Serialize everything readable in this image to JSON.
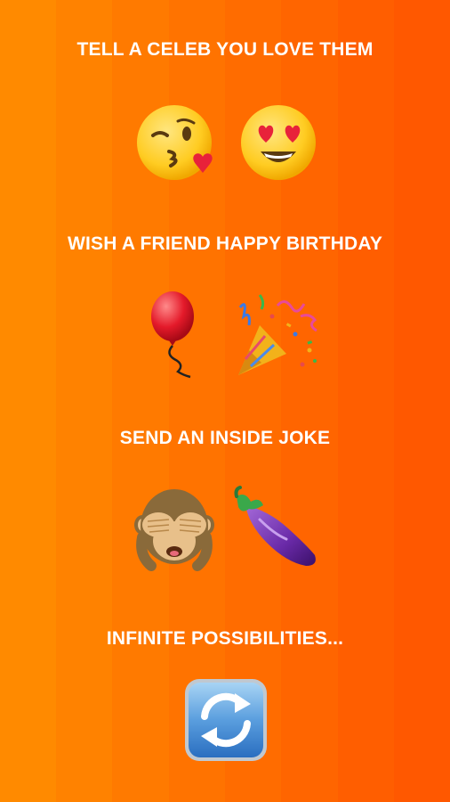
{
  "sections": [
    {
      "title": "TELL A CELEB YOU LOVE THEM",
      "emojis": [
        "face-blowing-kiss-icon",
        "smiling-face-heart-eyes-icon"
      ]
    },
    {
      "title": "WISH A FRIEND HAPPY BIRTHDAY",
      "emojis": [
        "balloon-icon",
        "party-popper-icon"
      ]
    },
    {
      "title": "SEND AN INSIDE JOKE",
      "emojis": [
        "see-no-evil-monkey-icon",
        "eggplant-icon"
      ]
    },
    {
      "title": "INFINITE POSSIBILITIES...",
      "emojis": [
        "repeat-arrows-icon"
      ]
    }
  ],
  "colors": {
    "background_left": "#ff8a00",
    "background_right": "#ff5800",
    "text": "#ffffff"
  }
}
